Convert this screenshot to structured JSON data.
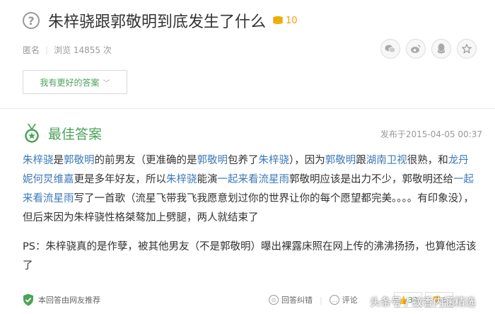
{
  "question": {
    "icon": "question-circle-icon",
    "title": "朱梓骁跟郭敬明到底发生了什么",
    "coin_icon": "coin-stack-icon",
    "reward": "10"
  },
  "meta": {
    "author": "匿名",
    "views": "浏览 14855 次"
  },
  "share": [
    {
      "icon": "wechat-icon",
      "glyph": "◐"
    },
    {
      "icon": "weibo-icon",
      "glyph": "◑"
    },
    {
      "icon": "qq-icon",
      "glyph": "♟"
    },
    {
      "icon": "star-icon",
      "glyph": "☆"
    }
  ],
  "better_answer_button": "我有更好的答案",
  "best_answer": {
    "icon": "medal-icon",
    "title": "最佳答案",
    "date": "发布于2015-04-05 00:37",
    "paragraph1": [
      {
        "t": "朱梓骁",
        "link": true
      },
      {
        "t": "是",
        "link": false
      },
      {
        "t": "郭敬明",
        "link": true
      },
      {
        "t": "的前男友（更准确的是",
        "link": false
      },
      {
        "t": "郭敬明",
        "link": true
      },
      {
        "t": "包养了",
        "link": false
      },
      {
        "t": "朱梓骁",
        "link": true
      },
      {
        "t": "），因为",
        "link": false
      },
      {
        "t": "郭敬明",
        "link": true
      },
      {
        "t": "跟",
        "link": false
      },
      {
        "t": "湖南卫视",
        "link": true
      },
      {
        "t": "很熟，和",
        "link": false
      },
      {
        "t": "龙丹妮",
        "link": true
      },
      {
        "t": "何炅",
        "link": true
      },
      {
        "t": "维嘉",
        "link": true
      },
      {
        "t": "更是多年好友，所以",
        "link": false
      },
      {
        "t": "朱梓骁",
        "link": true
      },
      {
        "t": "能演",
        "link": false
      },
      {
        "t": "一起来看流星雨",
        "link": true
      },
      {
        "t": "郭敬明应该是出力不少，郭敬明还给",
        "link": false
      },
      {
        "t": "一起来看流星雨",
        "link": true
      },
      {
        "t": "写了一首歌（流星飞带我飞我愿意划过你的世界让你的每个愿望都完美。。。。有印象没），但后来因为朱梓骁性格桀骜加上劈腿，两人就结束了",
        "link": false
      }
    ],
    "paragraph2": "PS：朱梓骁真的是作孽，被其他男友（不是郭敬明）曝出裸露床照在网上传的沸沸扬扬，也算他活该了"
  },
  "footer": {
    "recommend_icon": "shield-check-icon",
    "recommend": "本回答由网友推荐",
    "report": "回答纠错",
    "comment": "评论",
    "upvotes": "30",
    "downvotes": "6"
  },
  "watermark": "头条号 / 蚊香内涵精选"
}
